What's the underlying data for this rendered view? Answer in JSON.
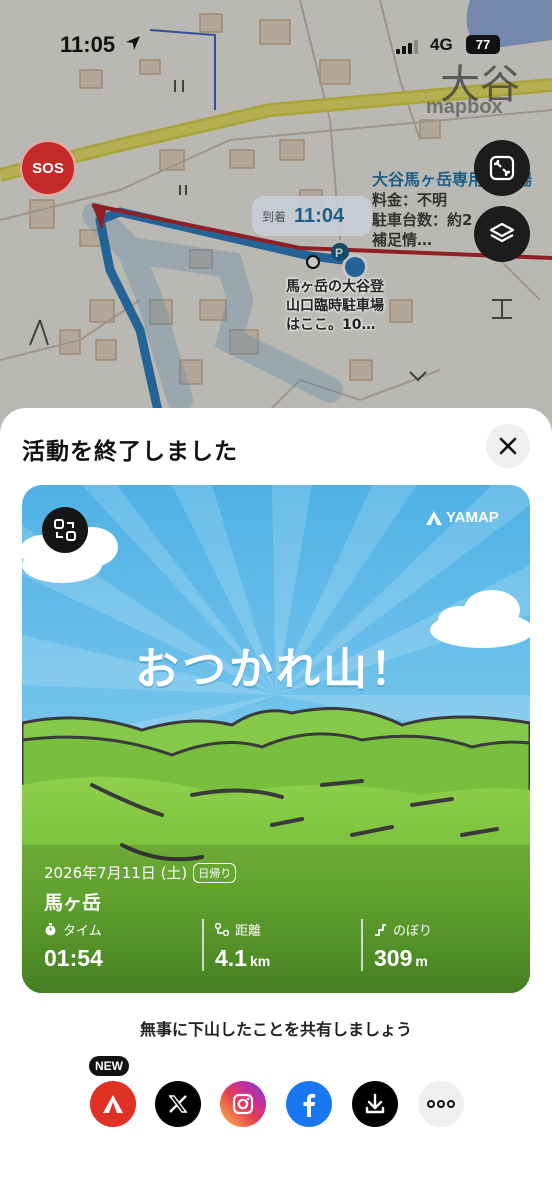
{
  "status_bar": {
    "time": "11:05",
    "network": "4G",
    "battery": "77"
  },
  "map": {
    "attribution": "mapbox",
    "kanji_label": "大谷",
    "sos_label": "SOS",
    "arrival_label": "到着",
    "arrival_time": "11:04",
    "parking_info": {
      "title": "大谷馬ヶ岳専用駐車場",
      "fee": "料金：不明",
      "spaces": "駐車台数：約2",
      "note": "補足情…"
    },
    "place_label_line1": "馬ヶ岳の大谷登",
    "place_label_line2": "山口臨時駐車場",
    "place_label_line3": "はここ。10…"
  },
  "sheet": {
    "title": "活動を終了しました",
    "card": {
      "brand": "YAMAP",
      "headline": "おつかれ山！",
      "date": "2026年7月11日 (土)",
      "trip_type": "日帰り",
      "mountain": "馬ヶ岳",
      "stats": [
        {
          "label": "タイム",
          "value": "01:54",
          "unit": ""
        },
        {
          "label": "距離",
          "value": "4.1",
          "unit": "km"
        },
        {
          "label": "のぼり",
          "value": "309",
          "unit": "m"
        }
      ]
    },
    "share_message": "無事に下山したことを共有しましょう",
    "new_badge": "NEW",
    "share_targets": [
      "yamap-icon",
      "x-icon",
      "instagram-icon",
      "facebook-icon",
      "download-icon",
      "more-icon"
    ]
  },
  "colors": {
    "sos": "#c52a2a",
    "route": "#2f7fc0",
    "sky": "#6fc4ee",
    "grass": "#78c23a"
  }
}
